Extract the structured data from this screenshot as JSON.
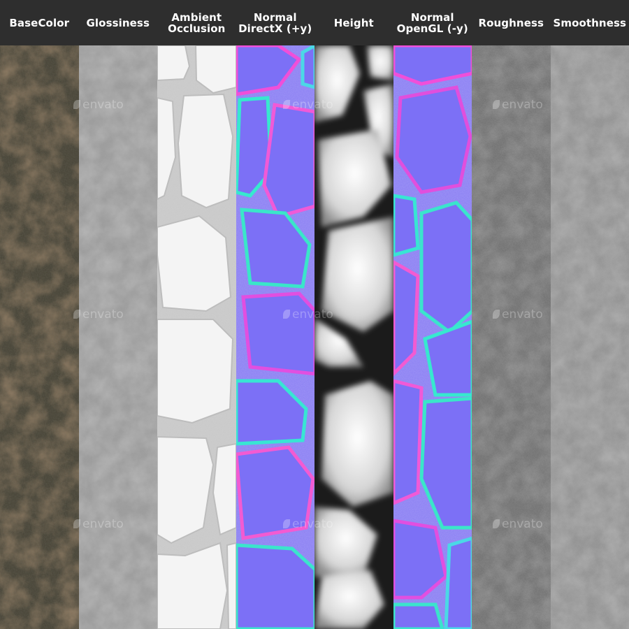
{
  "columns": [
    {
      "label": "BaseColor",
      "type": "basecolor"
    },
    {
      "label": "Glossiness",
      "type": "glossiness"
    },
    {
      "label": "Ambient Occlusion",
      "type": "ao"
    },
    {
      "label": "Normal DirectX (+y)",
      "type": "normal_dx"
    },
    {
      "label": "Height",
      "type": "height"
    },
    {
      "label": "Normal OpenGL (-y)",
      "type": "normal_gl"
    },
    {
      "label": "Roughness",
      "type": "roughness"
    },
    {
      "label": "Smoothness",
      "type": "smoothness"
    }
  ],
  "watermark": "envato",
  "colors": {
    "header_bg": "#2e2e2e",
    "header_text": "#ffffff",
    "basecolor": "#4a4638",
    "glossiness": "#9a9a9a",
    "ao_stone": "#f2f2f2",
    "ao_gap": "#cfcfcf",
    "normal_base": "#7b6ff0",
    "height_stone": "#d8d8d8",
    "height_gap": "#1a1a1a",
    "roughness": "#6e6e6e",
    "smoothness": "#8f8f8f"
  }
}
